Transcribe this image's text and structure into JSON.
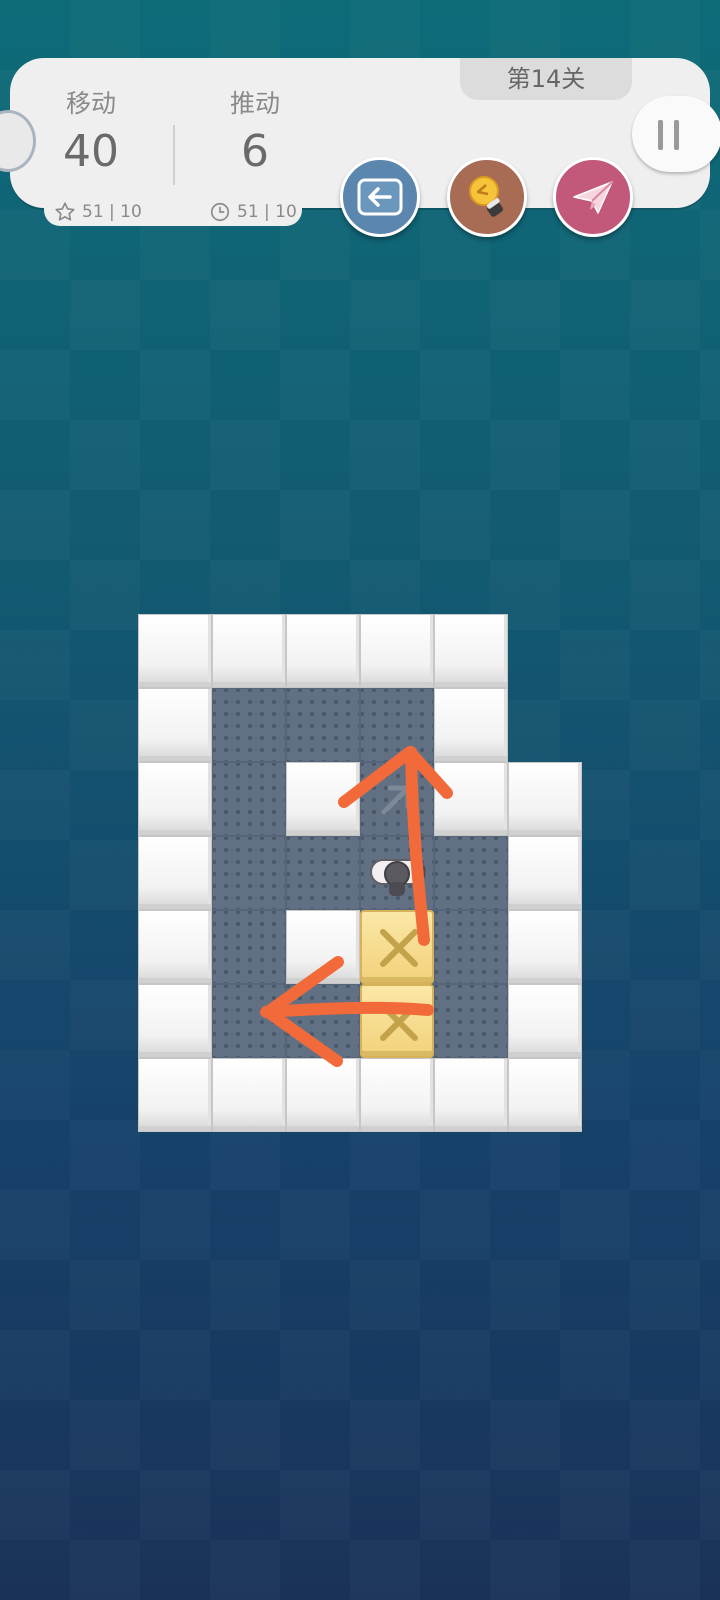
{
  "level": {
    "label": "第14关"
  },
  "stats": {
    "moves": {
      "label": "移动",
      "value": "40",
      "target": "51 | 10"
    },
    "pushes": {
      "label": "推动",
      "value": "6",
      "target": "51 | 10"
    }
  },
  "icons": {
    "target_star": "star-outline-icon",
    "target_clock": "clock-icon",
    "undo": "undo-arrow-icon",
    "hint": "lightbulb-icon",
    "share": "paper-plane-icon",
    "pause": "pause-icon"
  },
  "colors": {
    "undo_button": "#5b86ad",
    "hint_button": "#a86b53",
    "share_button": "#c2587a",
    "annotation_arrow": "#f26a3a",
    "box": "#f2d27b",
    "floor": "#617183"
  },
  "board": {
    "rows": [
      "WWWWW ",
      "W...W ",
      "W.W.WW",
      "W....W",
      "W.WB.W",
      "W..B.W",
      "WWWWWW"
    ],
    "legend": {
      "W": "wall",
      ".": "floor",
      "B": "box",
      " ": "empty"
    },
    "player": {
      "row": 3,
      "col": 3,
      "facing": "up"
    },
    "target_marker": {
      "row": 2,
      "col": 3
    }
  }
}
